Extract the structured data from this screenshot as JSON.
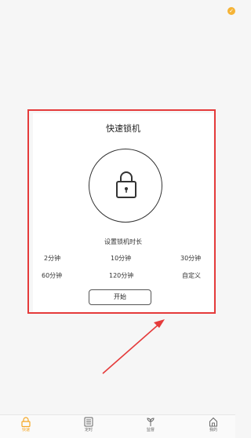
{
  "corner_badge": "✓",
  "card": {
    "title": "快速锁机",
    "duration_label": "设置锁机时长",
    "options": [
      "2分钟",
      "10分钟",
      "30分钟",
      "60分钟",
      "120分钟",
      "自定义"
    ],
    "start_label": "开始"
  },
  "tabbar": {
    "items": [
      {
        "label": "快速",
        "icon": "lock-icon",
        "active": true
      },
      {
        "label": "定时",
        "icon": "list-icon",
        "active": false
      },
      {
        "label": "监督",
        "icon": "plant-icon",
        "active": false
      },
      {
        "label": "我的",
        "icon": "home-icon",
        "active": false
      }
    ]
  },
  "colors": {
    "accent": "#f5a623",
    "annotation": "#e53b3b",
    "background": "#f6f6f6"
  }
}
